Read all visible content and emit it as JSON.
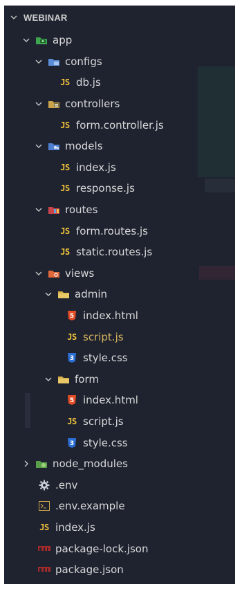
{
  "colors": {
    "background": "#1f2330",
    "text": "#d8d8d8",
    "js_badge": "#f0c23a",
    "html_icon": "#e44d26",
    "css_icon": "#2c6fd4",
    "folder": "#d9b04a",
    "active_text": "#d4b35f"
  },
  "explorer": {
    "section_title": "WEBINAR",
    "items": [
      {
        "label": "app",
        "type": "folder",
        "icon": "app-folder-icon",
        "expanded": true
      },
      {
        "label": "configs",
        "type": "folder",
        "icon": "configs-folder-icon",
        "expanded": true
      },
      {
        "label": "db.js",
        "type": "file",
        "badge": "JS"
      },
      {
        "label": "controllers",
        "type": "folder",
        "icon": "controllers-folder-icon",
        "expanded": true
      },
      {
        "label": "form.controller.js",
        "type": "file",
        "badge": "JS"
      },
      {
        "label": "models",
        "type": "folder",
        "icon": "models-folder-icon",
        "expanded": true
      },
      {
        "label": "index.js",
        "type": "file",
        "badge": "JS"
      },
      {
        "label": "response.js",
        "type": "file",
        "badge": "JS"
      },
      {
        "label": "routes",
        "type": "folder",
        "icon": "routes-folder-icon",
        "expanded": true
      },
      {
        "label": "form.routes.js",
        "type": "file",
        "badge": "JS"
      },
      {
        "label": "static.routes.js",
        "type": "file",
        "badge": "JS"
      },
      {
        "label": "views",
        "type": "folder",
        "icon": "views-folder-icon",
        "expanded": true
      },
      {
        "label": "admin",
        "type": "folder",
        "icon": "folder-icon",
        "expanded": true
      },
      {
        "label": "index.html",
        "type": "file",
        "icon": "html5-icon"
      },
      {
        "label": "script.js",
        "type": "file",
        "badge": "JS",
        "active": true
      },
      {
        "label": "style.css",
        "type": "file",
        "icon": "css3-icon"
      },
      {
        "label": "form",
        "type": "folder",
        "icon": "folder-icon",
        "expanded": true
      },
      {
        "label": "index.html",
        "type": "file",
        "icon": "html5-icon"
      },
      {
        "label": "script.js",
        "type": "file",
        "badge": "JS"
      },
      {
        "label": "style.css",
        "type": "file",
        "icon": "css3-icon"
      },
      {
        "label": "node_modules",
        "type": "folder",
        "icon": "node-modules-folder-icon",
        "expanded": false
      },
      {
        "label": ".env",
        "type": "file",
        "icon": "gear-icon"
      },
      {
        "label": ".env.example",
        "type": "file",
        "icon": "terminal-icon"
      },
      {
        "label": "index.js",
        "type": "file",
        "badge": "JS"
      },
      {
        "label": "package-lock.json",
        "type": "file",
        "icon": "npm-icon"
      },
      {
        "label": "package.json",
        "type": "file",
        "icon": "npm-icon"
      }
    ]
  }
}
